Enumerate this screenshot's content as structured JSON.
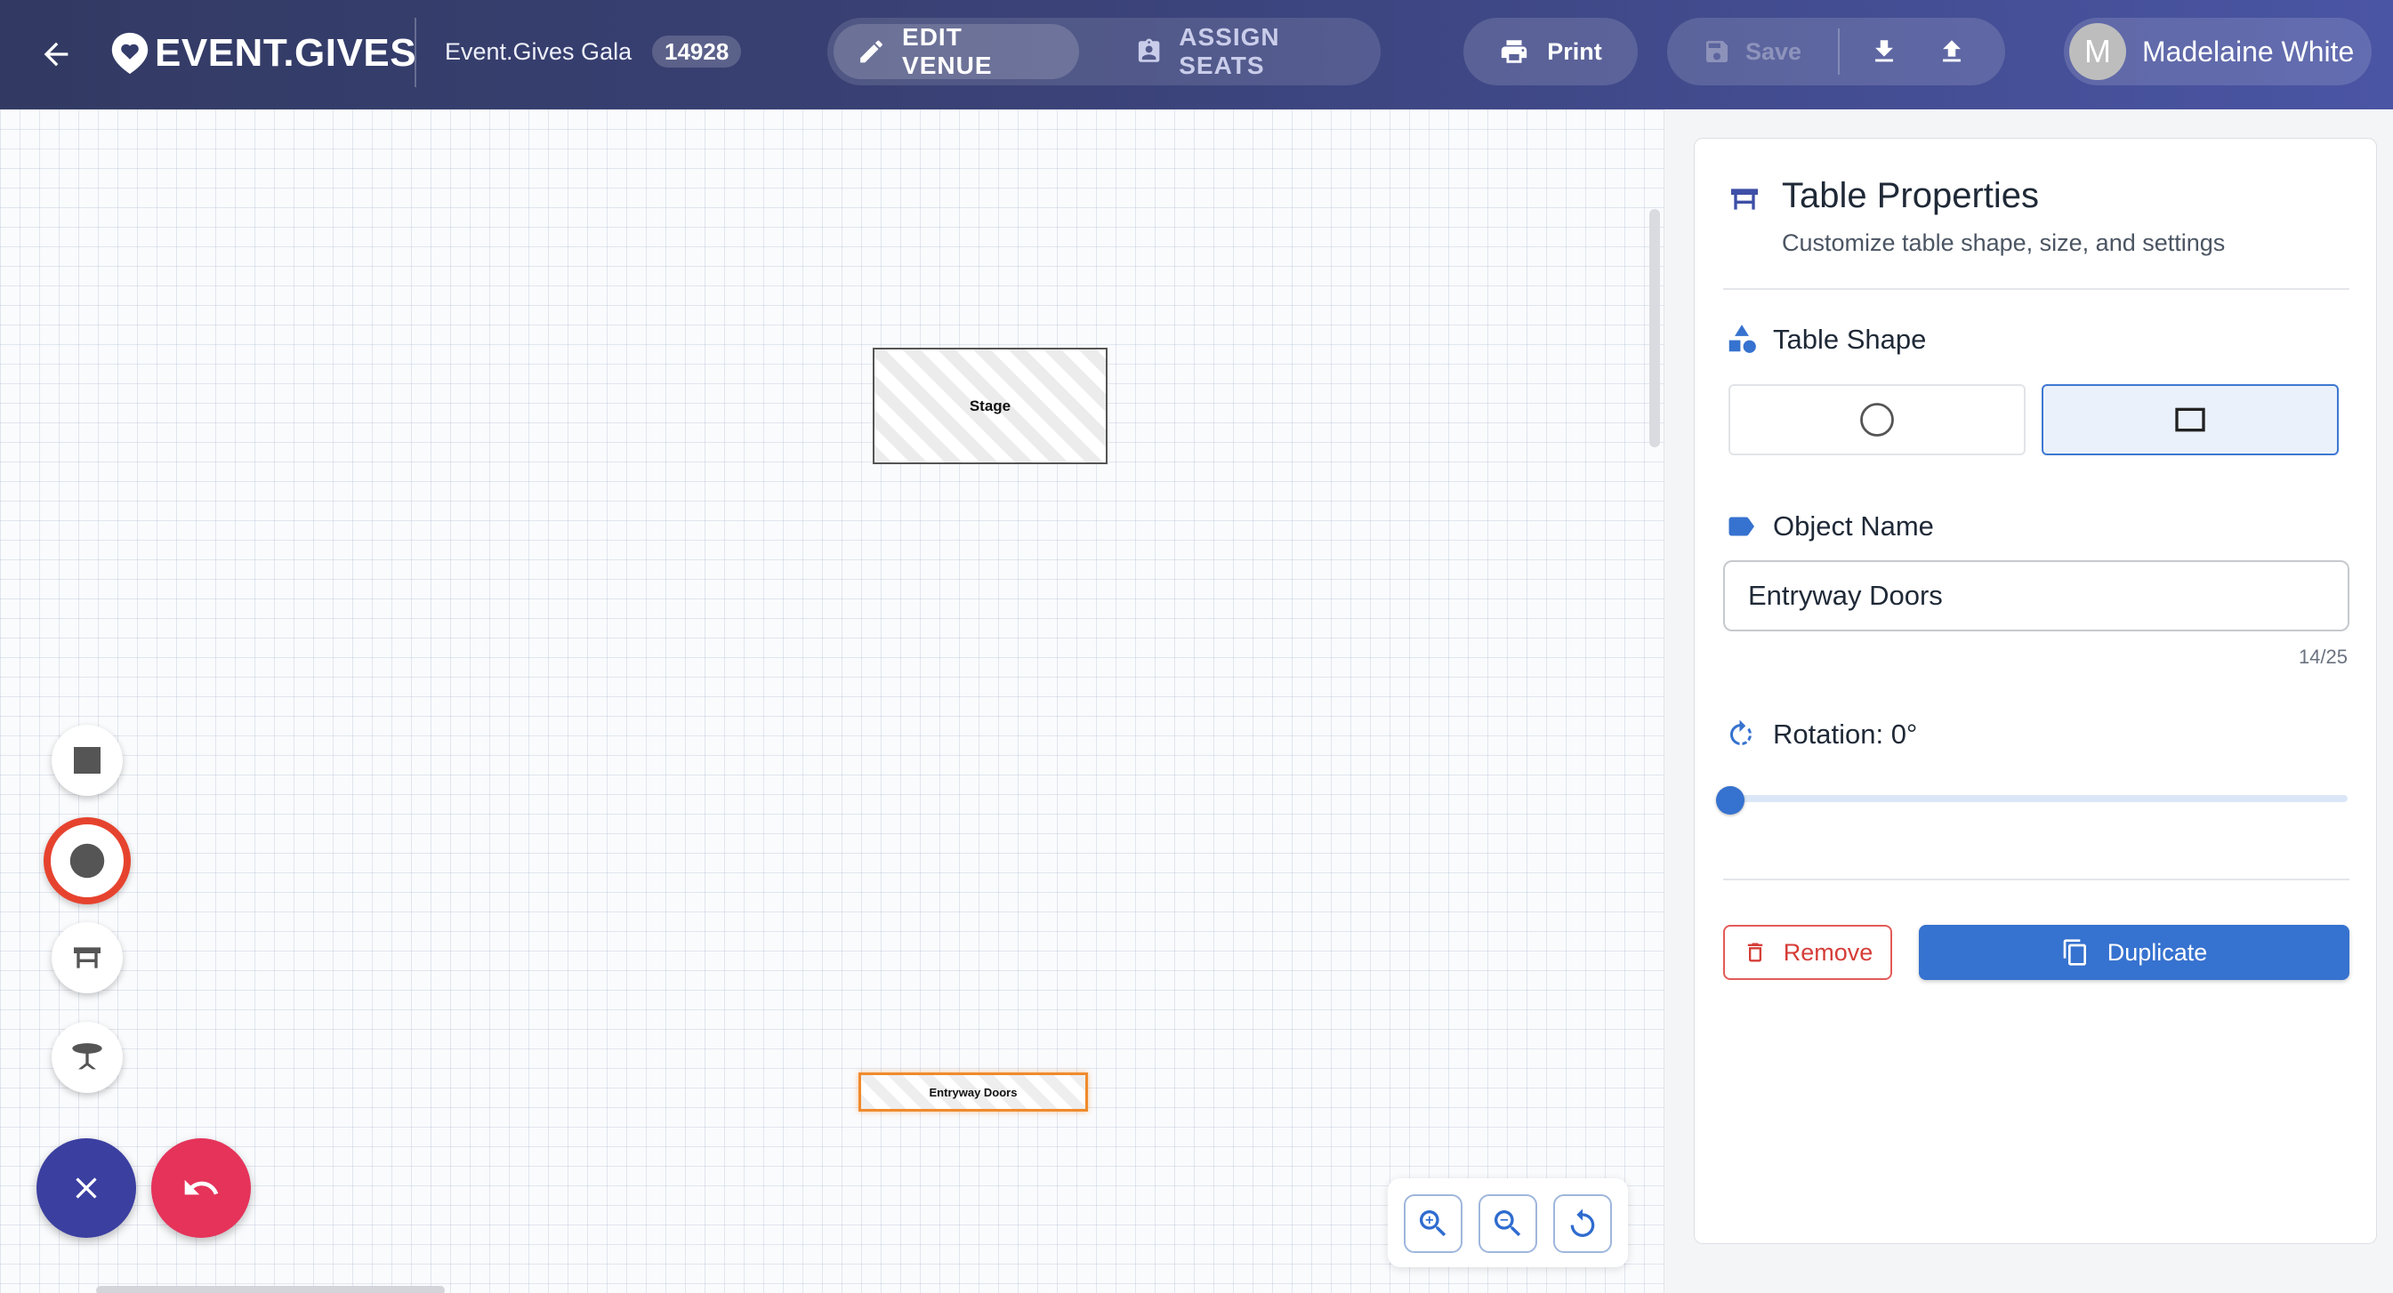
{
  "header": {
    "logo_text": "EVENT.GIVES",
    "event_name": "Event.Gives Gala",
    "event_id": "14928",
    "modes": [
      {
        "label": "EDIT VENUE",
        "active": true,
        "icon": "pencil-icon"
      },
      {
        "label": "ASSIGN SEATS",
        "active": false,
        "icon": "badge-icon"
      }
    ],
    "print_label": "Print",
    "save_label": "Save",
    "user": {
      "initial": "M",
      "name": "Madelaine White"
    }
  },
  "canvas": {
    "objects": [
      {
        "name": "Stage",
        "type": "rectangle",
        "selected": false
      },
      {
        "name": "Entryway Doors",
        "type": "rectangle",
        "selected": true
      }
    ],
    "tools": [
      "square-tool-icon",
      "circle-tool-icon",
      "rect-table-icon",
      "round-table-icon"
    ],
    "selected_tool": "circle-tool-icon",
    "zoom_controls": [
      "zoom-in-icon",
      "zoom-out-icon",
      "reset-view-icon"
    ]
  },
  "panel": {
    "title": "Table Properties",
    "subtitle": "Customize table shape, size, and settings",
    "shape_label": "Table Shape",
    "shapes": [
      {
        "name": "circle",
        "selected": false
      },
      {
        "name": "square",
        "selected": true
      }
    ],
    "object_name_label": "Object Name",
    "object_name_value": "Entryway Doors",
    "char_count": "14/25",
    "rotation_label": "Rotation: 0°",
    "rotation_value": 0,
    "rotation_max": 360,
    "remove_label": "Remove",
    "duplicate_label": "Duplicate"
  },
  "colors": {
    "accent": "#3672cf",
    "selection": "#f08a2c",
    "danger": "#d63d38",
    "fab_close": "#3b3fa0",
    "fab_undo": "#e5335a"
  }
}
